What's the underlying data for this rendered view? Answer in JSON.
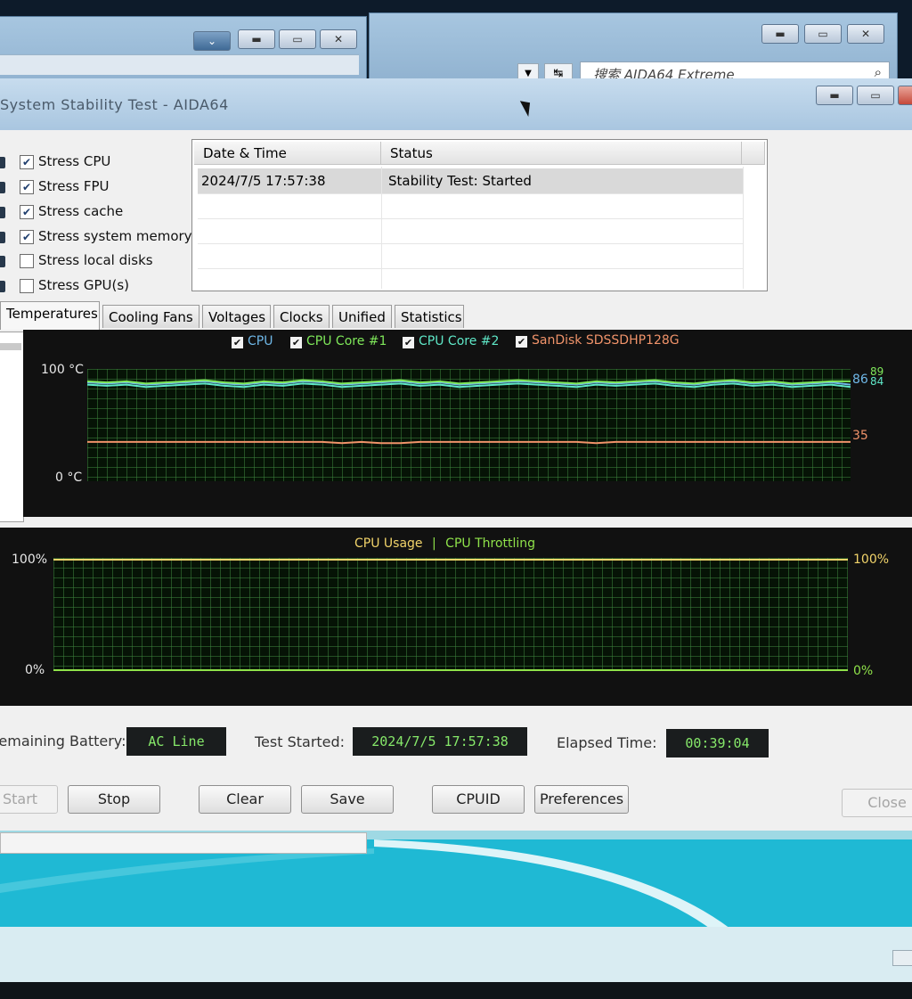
{
  "background_windows": {
    "search_placeholder": "搜索 AIDA64 Extreme"
  },
  "window": {
    "title": "System Stability Test - AIDA64"
  },
  "stress_options": [
    {
      "label": "Stress CPU",
      "checked": true
    },
    {
      "label": "Stress FPU",
      "checked": true
    },
    {
      "label": "Stress cache",
      "checked": true
    },
    {
      "label": "Stress system memory",
      "checked": true
    },
    {
      "label": "Stress local disks",
      "checked": false
    },
    {
      "label": "Stress GPU(s)",
      "checked": false
    }
  ],
  "log_table": {
    "headers": [
      "Date & Time",
      "Status"
    ],
    "rows": [
      [
        "2024/7/5 17:57:38",
        "Stability Test: Started"
      ]
    ]
  },
  "tabs": [
    "Temperatures",
    "Cooling Fans",
    "Voltages",
    "Clocks",
    "Unified",
    "Statistics"
  ],
  "active_tab": "Temperatures",
  "temperature_graph": {
    "legend": [
      {
        "label": "CPU",
        "color": "#6fb8e8"
      },
      {
        "label": "CPU Core #1",
        "color": "#7fe85a"
      },
      {
        "label": "CPU Core #2",
        "color": "#5fe8c8"
      },
      {
        "label": "SanDisk SDSSDHP128G",
        "color": "#f0936a"
      }
    ],
    "y_max_label": "100 °C",
    "y_min_label": "0 °C",
    "end_values": [
      "86",
      "89",
      "84",
      "35"
    ]
  },
  "usage_graph": {
    "legend_usage": "CPU Usage",
    "legend_sep": "|",
    "legend_throttle": "CPU Throttling",
    "usage_color": "#f2d46a",
    "throttle_color": "#8fe24a",
    "left_max": "100%",
    "left_min": "0%",
    "right_max": "100%",
    "right_min": "0%"
  },
  "info": {
    "battery_label": "Remaining Battery:",
    "battery_value": "AC Line",
    "started_label": "Test Started:",
    "started_value": "2024/7/5 17:57:38",
    "elapsed_label": "Elapsed Time:",
    "elapsed_value": "00:39:04"
  },
  "buttons": {
    "start": "Start",
    "stop": "Stop",
    "clear": "Clear",
    "save": "Save",
    "cpuid": "CPUID",
    "preferences": "Preferences",
    "close": "Close"
  },
  "chart_data": [
    {
      "type": "line",
      "title": "",
      "ylabel": "",
      "ylim": [
        0,
        100
      ],
      "series": [
        {
          "name": "CPU",
          "values": [
            88,
            87,
            88,
            86,
            87,
            88,
            89,
            87,
            86,
            88,
            87,
            89,
            88,
            86,
            87,
            88,
            89,
            87,
            88,
            86,
            87,
            88,
            89,
            88,
            87,
            86,
            88,
            87,
            88,
            89,
            87,
            86,
            88,
            89,
            87,
            88,
            86,
            87,
            88,
            86
          ]
        },
        {
          "name": "CPU Core #1",
          "values": [
            89,
            88,
            89,
            87,
            88,
            89,
            90,
            88,
            87,
            89,
            88,
            90,
            89,
            87,
            88,
            89,
            90,
            88,
            89,
            87,
            88,
            89,
            90,
            89,
            88,
            87,
            89,
            88,
            89,
            90,
            88,
            87,
            89,
            90,
            88,
            89,
            87,
            88,
            89,
            89
          ]
        },
        {
          "name": "CPU Core #2",
          "values": [
            86,
            85,
            86,
            84,
            85,
            86,
            87,
            85,
            84,
            86,
            85,
            87,
            86,
            84,
            85,
            86,
            87,
            85,
            86,
            84,
            85,
            86,
            87,
            86,
            85,
            84,
            86,
            85,
            86,
            87,
            85,
            84,
            86,
            87,
            85,
            86,
            84,
            85,
            86,
            84
          ]
        },
        {
          "name": "SanDisk SDSSDHP128G",
          "values": [
            35,
            35,
            35,
            35,
            35,
            35,
            35,
            35,
            35,
            35,
            35,
            35,
            35,
            34,
            35,
            34,
            34,
            35,
            35,
            35,
            35,
            35,
            35,
            35,
            35,
            35,
            34,
            35,
            35,
            35,
            35,
            35,
            35,
            35,
            35,
            35,
            35,
            35,
            35,
            35
          ]
        }
      ]
    },
    {
      "type": "line",
      "title": "",
      "ylim": [
        0,
        100
      ],
      "series": [
        {
          "name": "CPU Usage",
          "values": [
            100,
            100,
            100,
            100,
            100,
            100,
            100,
            100,
            100,
            100
          ]
        },
        {
          "name": "CPU Throttling",
          "values": [
            0,
            0,
            0,
            0,
            0,
            0,
            0,
            0,
            0,
            0
          ]
        }
      ]
    }
  ]
}
